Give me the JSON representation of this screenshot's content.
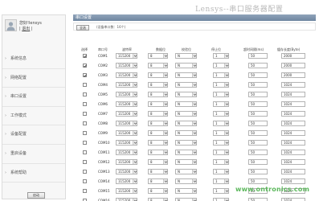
{
  "banner": {
    "title": "Lensys--串口服务器配置"
  },
  "user": {
    "line": "您好!lensys",
    "logout_prefix": "| ",
    "logout": "退出",
    "logout_suffix": " |"
  },
  "nav": {
    "items": [
      {
        "label": "系统信息"
      },
      {
        "label": "网络配置"
      },
      {
        "label": "串口设置"
      },
      {
        "label": "工作模式"
      },
      {
        "label": "设备配置"
      },
      {
        "label": "重启设备"
      },
      {
        "label": "系统帮助"
      }
    ],
    "start_button": "启动"
  },
  "main": {
    "header": "串口设置",
    "select_all": "全选",
    "port_count": "(设备串口数：16个)"
  },
  "table": {
    "headers": [
      "选择",
      "串口号",
      "波特率",
      "数据位",
      "校验位",
      "停止位",
      "超时间隔(ms)",
      "缓存长度(Byte)"
    ],
    "rows": [
      {
        "checked": true,
        "port": "COM1",
        "baud": "115200",
        "data_bits": "8",
        "parity": "N",
        "stop_bits": "1",
        "timeout": "50",
        "buffer": "2000"
      },
      {
        "checked": true,
        "port": "COM2",
        "baud": "115200",
        "data_bits": "8",
        "parity": "N",
        "stop_bits": "1",
        "timeout": "50",
        "buffer": "2000"
      },
      {
        "checked": true,
        "port": "COM3",
        "baud": "115200",
        "data_bits": "8",
        "parity": "N",
        "stop_bits": "1",
        "timeout": "50",
        "buffer": "2000"
      },
      {
        "checked": false,
        "port": "COM4",
        "baud": "115200",
        "data_bits": "8",
        "parity": "N",
        "stop_bits": "1",
        "timeout": "50",
        "buffer": "1024"
      },
      {
        "checked": false,
        "port": "COM5",
        "baud": "115200",
        "data_bits": "8",
        "parity": "N",
        "stop_bits": "1",
        "timeout": "50",
        "buffer": "1024"
      },
      {
        "checked": false,
        "port": "COM6",
        "baud": "115200",
        "data_bits": "8",
        "parity": "N",
        "stop_bits": "1",
        "timeout": "50",
        "buffer": "1024"
      },
      {
        "checked": false,
        "port": "COM7",
        "baud": "115200",
        "data_bits": "8",
        "parity": "N",
        "stop_bits": "1",
        "timeout": "50",
        "buffer": "1024"
      },
      {
        "checked": false,
        "port": "COM8",
        "baud": "115200",
        "data_bits": "8",
        "parity": "N",
        "stop_bits": "1",
        "timeout": "50",
        "buffer": "1024"
      },
      {
        "checked": false,
        "port": "COM9",
        "baud": "115200",
        "data_bits": "8",
        "parity": "N",
        "stop_bits": "1",
        "timeout": "50",
        "buffer": "1024"
      },
      {
        "checked": false,
        "port": "COM10",
        "baud": "115200",
        "data_bits": "8",
        "parity": "N",
        "stop_bits": "1",
        "timeout": "50",
        "buffer": "1024"
      },
      {
        "checked": false,
        "port": "COM11",
        "baud": "115200",
        "data_bits": "8",
        "parity": "N",
        "stop_bits": "1",
        "timeout": "50",
        "buffer": "1024"
      },
      {
        "checked": false,
        "port": "COM12",
        "baud": "115200",
        "data_bits": "8",
        "parity": "N",
        "stop_bits": "1",
        "timeout": "50",
        "buffer": "1024"
      },
      {
        "checked": false,
        "port": "COM13",
        "baud": "115200",
        "data_bits": "8",
        "parity": "N",
        "stop_bits": "1",
        "timeout": "50",
        "buffer": "1024"
      },
      {
        "checked": false,
        "port": "COM14",
        "baud": "115200",
        "data_bits": "8",
        "parity": "N",
        "stop_bits": "1",
        "timeout": "50",
        "buffer": "1024"
      },
      {
        "checked": false,
        "port": "COM15",
        "baud": "115200",
        "data_bits": "8",
        "parity": "N",
        "stop_bits": "1",
        "timeout": "50",
        "buffer": "1024"
      },
      {
        "checked": false,
        "port": "COM16",
        "baud": "115200",
        "data_bits": "8",
        "parity": "N",
        "stop_bits": "1",
        "timeout": "50",
        "buffer": "1024"
      }
    ]
  },
  "watermark": "www.ontronics.com",
  "icons": {
    "avatar": "user-avatar-icon",
    "nav": "chevron-right-icon",
    "select": "chevron-down-icon",
    "check": "check-icon"
  },
  "colors": {
    "header_bar": "#7d92ab",
    "watermark": "#5db85d"
  }
}
